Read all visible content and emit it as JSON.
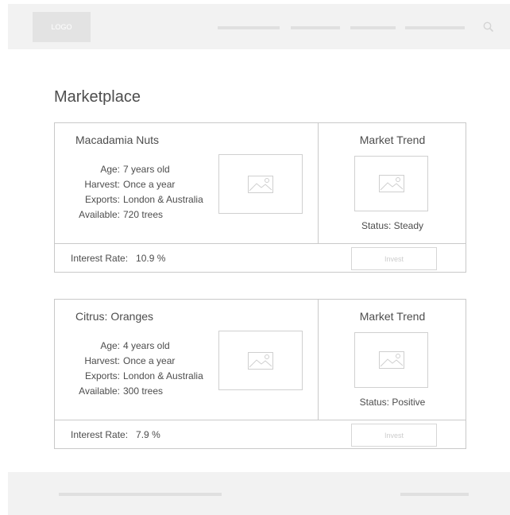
{
  "header": {
    "logo_text": "LOGO",
    "nav_items": [
      "nav-link-1",
      "nav-link-2",
      "nav-link-3",
      "nav-link-4"
    ],
    "search_icon": "search-icon"
  },
  "page": {
    "title": "Marketplace"
  },
  "listings": [
    {
      "name": "Macadamia Nuts",
      "details": [
        {
          "label": "Age:",
          "value": "7 years old"
        },
        {
          "label": "Harvest:",
          "value": "Once a year"
        },
        {
          "label": "Exports:",
          "value": "London & Australia"
        },
        {
          "label": "Available:",
          "value": "720 trees"
        }
      ],
      "trend_title": "Market Trend",
      "status": "Status: Steady",
      "interest_label": "Interest Rate:",
      "interest_value": "10.9 %",
      "invest_label": "Invest"
    },
    {
      "name": "Citrus: Oranges",
      "details": [
        {
          "label": "Age:",
          "value": "4 years old"
        },
        {
          "label": "Harvest:",
          "value": "Once a year"
        },
        {
          "label": "Exports:",
          "value": "London & Australia"
        },
        {
          "label": "Available:",
          "value": "300 trees"
        }
      ],
      "trend_title": "Market Trend",
      "status": "Status: Positive",
      "interest_label": "Interest Rate:",
      "interest_value": "7.9 %",
      "invest_label": "Invest"
    }
  ],
  "icons": {
    "image_placeholder": "image-placeholder-icon"
  },
  "colors": {
    "placeholder_gray": "#f2f2f2",
    "border": "#c9c9c9",
    "text": "#4d4d4d"
  }
}
